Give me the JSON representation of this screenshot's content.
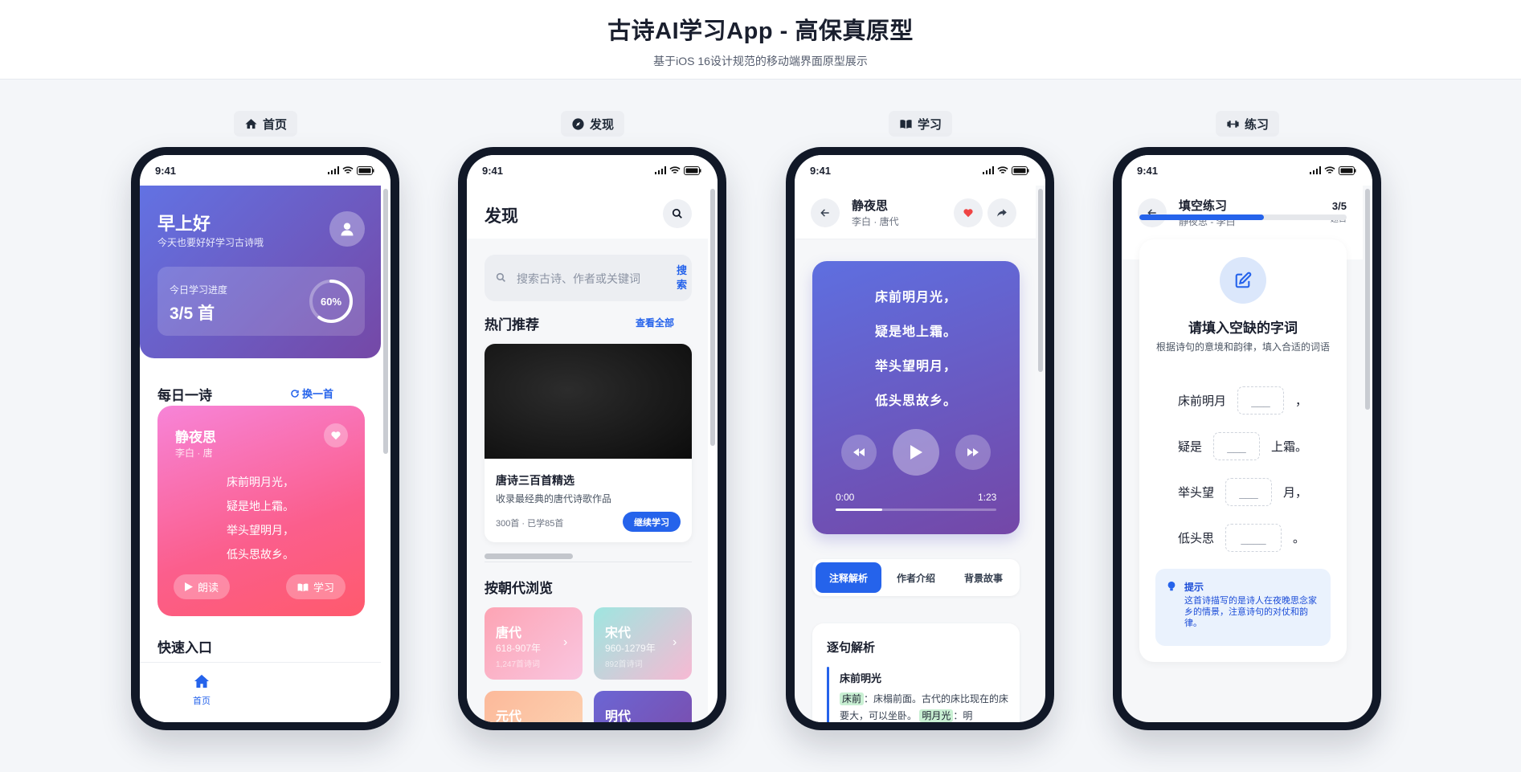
{
  "header": {
    "title": "古诗AI学习App - 高保真原型",
    "subtitle": "基于iOS 16设计规范的移动端界面原型展示"
  },
  "status": {
    "time": "9:41"
  },
  "phones": [
    {
      "caption": "首页",
      "icon": "home-icon"
    },
    {
      "caption": "发现",
      "icon": "compass-icon"
    },
    {
      "caption": "学习",
      "icon": "book-icon"
    },
    {
      "caption": "练习",
      "icon": "dumbbell-icon"
    }
  ],
  "home": {
    "greeting": "早上好",
    "greeting_sub": "今天也要好好学习古诗哦",
    "progress_label": "今日学习进度",
    "progress_value": "3/5 首",
    "progress_percent": "60%",
    "progress_fraction": 0.6,
    "daily_title": "每日一诗",
    "refresh_label": "换一首",
    "poem": {
      "title": "静夜思",
      "author": "李白 · 唐",
      "lines": [
        "床前明月光，",
        "疑是地上霜。",
        "举头望明月，",
        "低头思故乡。"
      ]
    },
    "read_label": "朗读",
    "study_label": "学习",
    "quick_title": "快速入口",
    "tab_home": "首页"
  },
  "discover": {
    "title": "发现",
    "search_placeholder": "搜索古诗、作者或关键词",
    "search_button": "搜索",
    "hot_title": "热门推荐",
    "view_all": "查看全部",
    "feature": {
      "title": "唐诗三百首精选",
      "desc": "收录最经典的唐代诗歌作品",
      "meta": "300首 · 已学85首",
      "button": "继续学习"
    },
    "dynasty_title": "按朝代浏览",
    "dynasties": [
      {
        "name": "唐代",
        "years": "618-907年",
        "count": "1,247首诗词",
        "color1": "#fda4b4",
        "color2": "#f9c6e0"
      },
      {
        "name": "宋代",
        "years": "960-1279年",
        "count": "892首诗词",
        "color1": "#9ee6e0",
        "color2": "#f7b9d3"
      },
      {
        "name": "元代",
        "years": "",
        "count": "",
        "color1": "#fcb99a",
        "color2": "#fdd6b5"
      },
      {
        "name": "明代",
        "years": "",
        "count": "",
        "color1": "#6b66d4",
        "color2": "#7d4aa8"
      }
    ]
  },
  "study": {
    "title": "静夜思",
    "author": "李白 · 唐代",
    "lines": [
      "床前明月光，",
      "疑是地上霜。",
      "举头望明月，",
      "低头思故乡。"
    ],
    "time_current": "0:00",
    "time_total": "1:23",
    "played_fraction": 0.29,
    "tabs": [
      "注释解析",
      "作者介绍",
      "背景故事"
    ],
    "section_title": "逐句解析",
    "line_title": "床前明光",
    "term1": "床前",
    "term1_text": "：床榻前面。古代的床比现在的床要大，可以坐卧。",
    "term2": "明月光",
    "term2_text": "：明"
  },
  "practice": {
    "title": "填空练习",
    "subtitle": "静夜思 - 李白",
    "count": "3/5",
    "count_unit": "题目",
    "progress_fraction": 0.6,
    "question": "请填入空缺的字词",
    "instruction": "根据诗句的意境和韵律，填入合适的词语",
    "rows": [
      {
        "before": "床前明月",
        "blank": "___",
        "after": "，"
      },
      {
        "before": "疑是",
        "blank": "___",
        "after": "上霜。"
      },
      {
        "before": "举头望",
        "blank": "___",
        "after": "月，"
      },
      {
        "before": "低头思",
        "blank": "____",
        "after": "。"
      }
    ],
    "hint_title": "提示",
    "hint_text": "这首诗描写的是诗人在夜晚思念家乡的情景，注意诗句的对仗和韵律。"
  }
}
